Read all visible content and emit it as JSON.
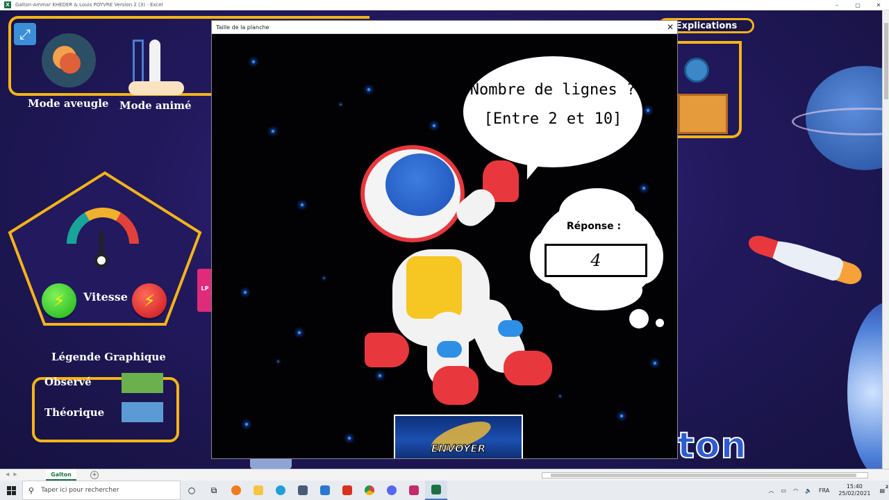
{
  "window": {
    "title": "Galton-Ammar KHEDER & Louis POYVRE Version 2 (3) - Excel",
    "controls": [
      "–",
      "▢",
      "✕"
    ]
  },
  "sheet": {
    "modes": {
      "blind": "Mode aveugle",
      "animated": "Mode animé"
    },
    "speed_label": "Vitesse",
    "legend": {
      "title": "Légende Graphique",
      "observed": "Observé",
      "theoretical": "Théorique",
      "observed_color": "#6ab04c",
      "theoretical_color": "#5b9bd5"
    },
    "explications_label": "Explications",
    "bottom_title": "ton",
    "tab_name": "Galton",
    "side_badge": "LP"
  },
  "dialog": {
    "title": "Taille de la planche",
    "close": "✕",
    "question_line1": "Nombre de lignes ?",
    "question_line2": "[Entre 2 et 10]",
    "reply_label": "Réponse :",
    "reply_value": "4",
    "send_label": "ENVOYER"
  },
  "taskbar": {
    "search_placeholder": "Taper ici pour rechercher",
    "lang": "FRA",
    "time": "15:40",
    "date": "25/02/2021",
    "notification_count": "2"
  },
  "colors": {
    "gold": "#f5b417",
    "excel_green": "#1d7044",
    "star_blue": "#3f8cff"
  }
}
